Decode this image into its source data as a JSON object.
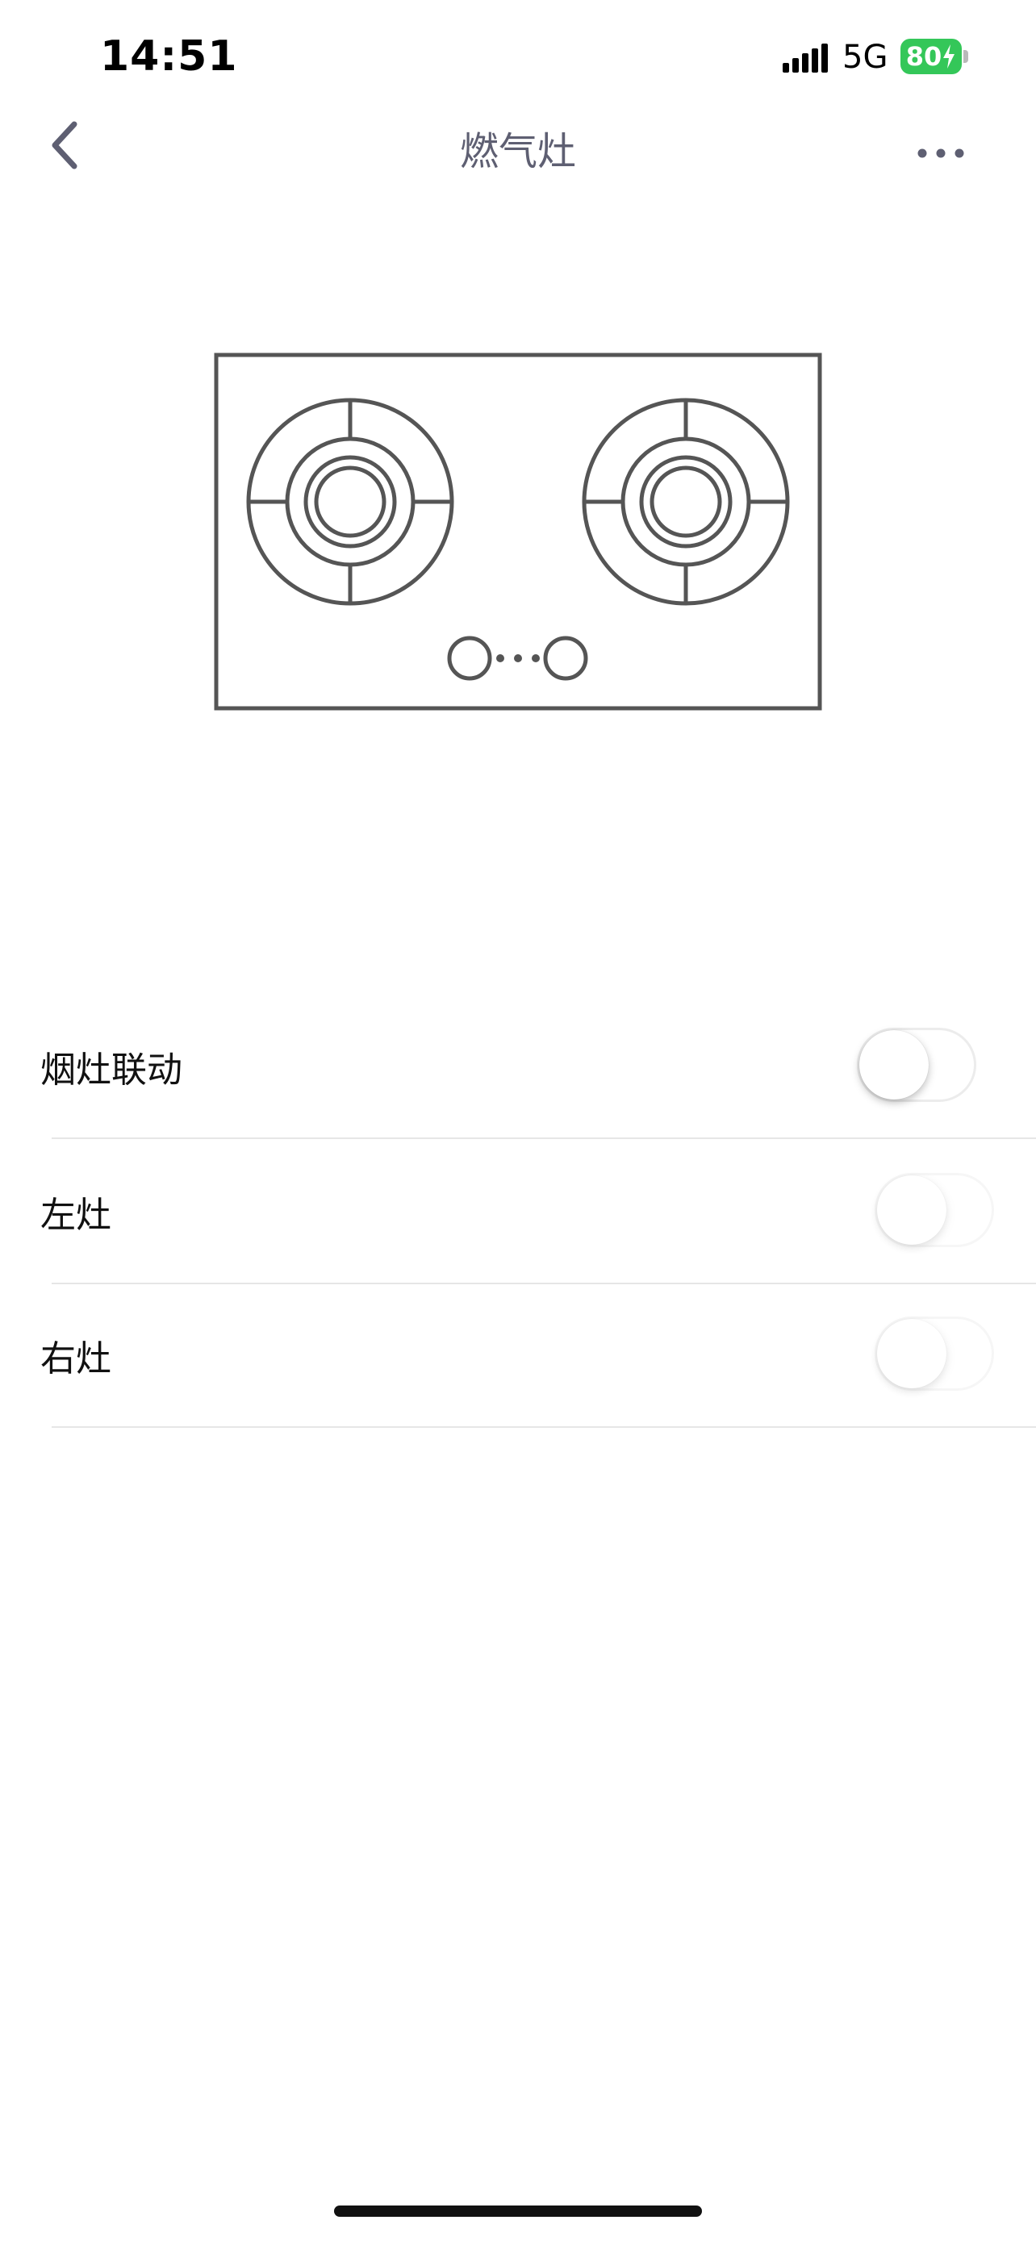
{
  "status_bar": {
    "time": "14:51",
    "network": "5G",
    "battery_level": "80",
    "battery_charging": true,
    "battery_color": "#34c759"
  },
  "nav": {
    "title": "燃气灶",
    "back_icon": "chevron-left-icon",
    "more_icon": "more-dots-icon"
  },
  "illustration": {
    "icon": "gas-stove-icon",
    "stroke_color": "#555555"
  },
  "settings": [
    {
      "label": "烟灶联动",
      "on": false,
      "enabled": true
    },
    {
      "label": "左灶",
      "on": false,
      "enabled": false
    },
    {
      "label": "右灶",
      "on": false,
      "enabled": false
    }
  ]
}
